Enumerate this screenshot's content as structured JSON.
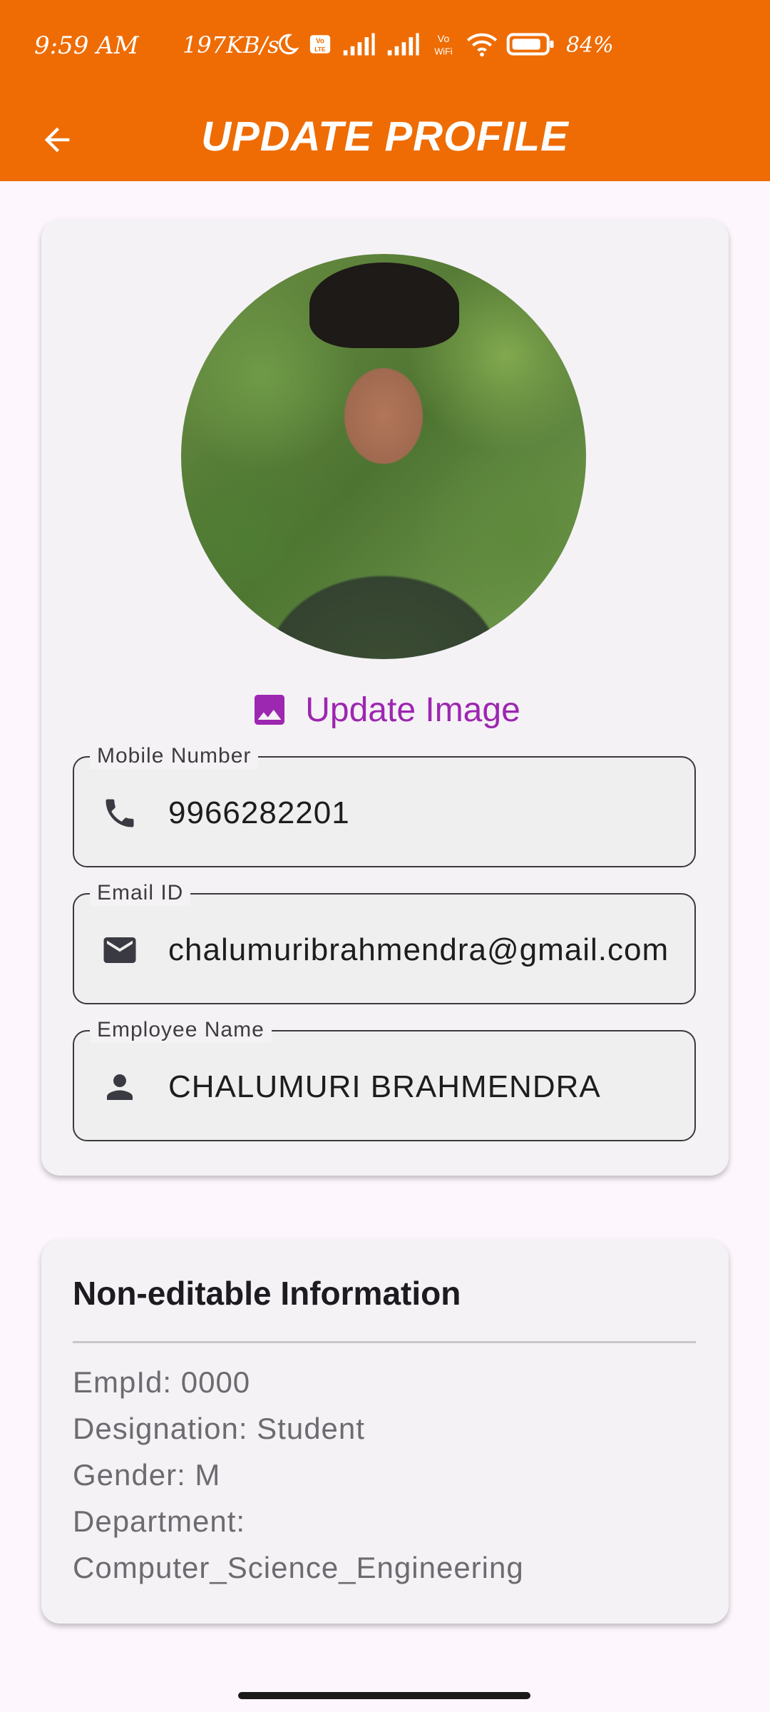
{
  "status_bar": {
    "time": "9:59 AM",
    "network_speed": "197KB/s",
    "battery_percent": "84%",
    "icons": [
      "moon-icon",
      "volte-icon",
      "signal-icon",
      "signal-icon",
      "vowifi-icon",
      "wifi-icon",
      "battery-icon"
    ]
  },
  "app_bar": {
    "title": "UPDATE PROFILE",
    "back_icon": "arrow-left-icon",
    "color": "#ee6c03"
  },
  "profile": {
    "update_image_label": "Update Image",
    "update_image_icon": "image-icon",
    "accent_color": "#9c27b0"
  },
  "fields": {
    "mobile": {
      "label": "Mobile Number",
      "value": "9966282201",
      "icon": "phone-icon"
    },
    "email": {
      "label": "Email ID",
      "value": "chalumuribrahmendra@gmail.com",
      "icon": "mail-icon"
    },
    "name": {
      "label": "Employee Name",
      "value": "CHALUMURI BRAHMENDRA",
      "icon": "person-icon"
    }
  },
  "non_editable": {
    "title": "Non-editable Information",
    "lines": [
      "EmpId: 0000",
      "Designation: Student",
      "Gender: M",
      "Department:",
      "Computer_Science_Engineering"
    ]
  }
}
